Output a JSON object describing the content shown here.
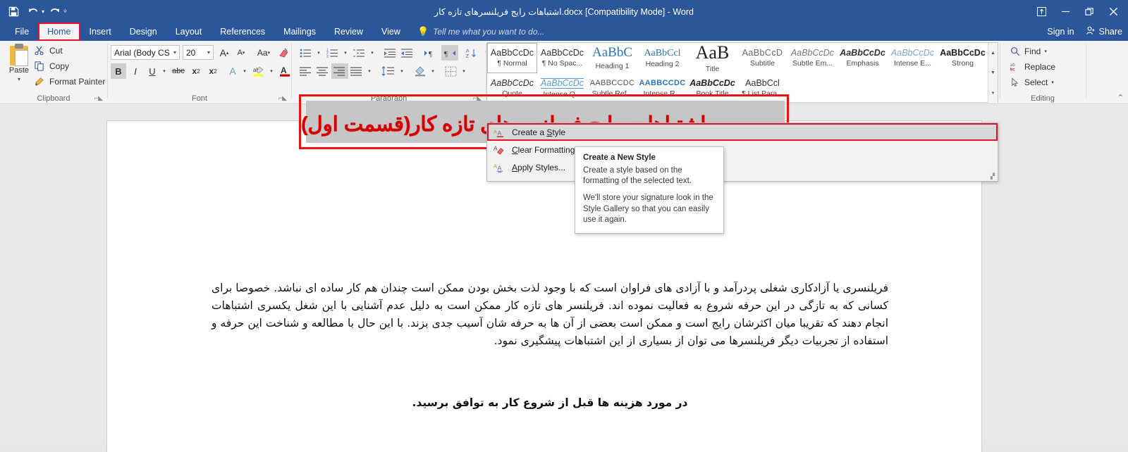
{
  "titlebar": {
    "document_title": "اشتباهات رایج فریلنسرهای تازه کار.docx [Compatibility Mode] - Word",
    "qat": [
      {
        "name": "save-icon",
        "glyph": "💾"
      },
      {
        "name": "undo-icon",
        "glyph": "↶"
      },
      {
        "name": "redo-icon",
        "glyph": "↷"
      },
      {
        "name": "customize-qat-icon",
        "glyph": "⌄"
      }
    ],
    "window_controls": [
      {
        "name": "ribbon-display-options-icon",
        "glyph": "⬆"
      },
      {
        "name": "minimize-icon",
        "glyph": "—"
      },
      {
        "name": "restore-icon",
        "glyph": "❐"
      },
      {
        "name": "close-icon",
        "glyph": "✕"
      }
    ]
  },
  "tabs": [
    {
      "label": "File",
      "active": false
    },
    {
      "label": "Home",
      "active": true
    },
    {
      "label": "Insert",
      "active": false
    },
    {
      "label": "Design",
      "active": false
    },
    {
      "label": "Layout",
      "active": false
    },
    {
      "label": "References",
      "active": false
    },
    {
      "label": "Mailings",
      "active": false
    },
    {
      "label": "Review",
      "active": false
    },
    {
      "label": "View",
      "active": false
    }
  ],
  "tell_me": {
    "text": "Tell me what you want to do...",
    "icon": "lightbulb-icon"
  },
  "account": {
    "sign_in": "Sign in",
    "share": "Share",
    "share_icon": "person-add-icon"
  },
  "ribbon": {
    "clipboard": {
      "group_label": "Clipboard",
      "paste_label": "Paste",
      "items": [
        {
          "label": "Cut",
          "icon": "scissors-icon"
        },
        {
          "label": "Copy",
          "icon": "copy-icon"
        },
        {
          "label": "Format Painter",
          "icon": "paintbrush-icon"
        }
      ]
    },
    "font": {
      "group_label": "Font",
      "font_name": "Arial (Body CS",
      "font_size": "20",
      "buttons": [
        {
          "name": "grow-font",
          "glyph": "A"
        },
        {
          "name": "shrink-font",
          "glyph": "A"
        },
        {
          "name": "change-case",
          "glyph": "Aa"
        },
        {
          "name": "clear-formatting",
          "glyph": "✐"
        },
        {
          "name": "bold",
          "glyph": "B",
          "active": true
        },
        {
          "name": "italic",
          "glyph": "I"
        },
        {
          "name": "underline",
          "glyph": "U"
        },
        {
          "name": "strikethrough",
          "glyph": "abc"
        },
        {
          "name": "subscript",
          "glyph": "x₂"
        },
        {
          "name": "superscript",
          "glyph": "x²"
        },
        {
          "name": "text-effects",
          "glyph": "A"
        },
        {
          "name": "text-highlight-color",
          "glyph": "ab"
        },
        {
          "name": "font-color",
          "glyph": "A"
        }
      ]
    },
    "paragraph": {
      "group_label": "Paragraph",
      "buttons": [
        {
          "name": "bullets",
          "glyph": "≣"
        },
        {
          "name": "numbering",
          "glyph": "≣"
        },
        {
          "name": "multilevel-list",
          "glyph": "≣"
        },
        {
          "name": "decrease-indent",
          "glyph": "⇥"
        },
        {
          "name": "increase-indent",
          "glyph": "⇤"
        },
        {
          "name": "ltr-text-direction",
          "glyph": "▶¶"
        },
        {
          "name": "rtl-text-direction",
          "glyph": "¶◀",
          "active": true
        },
        {
          "name": "sort",
          "glyph": "A↓"
        },
        {
          "name": "show-formatting-marks",
          "glyph": "¶"
        },
        {
          "name": "align-left",
          "glyph": "≡"
        },
        {
          "name": "align-center",
          "glyph": "≡"
        },
        {
          "name": "align-right",
          "glyph": "≡",
          "active": true
        },
        {
          "name": "justify",
          "glyph": "≡"
        },
        {
          "name": "line-spacing",
          "glyph": "↕"
        },
        {
          "name": "shading",
          "glyph": "◢"
        },
        {
          "name": "borders",
          "glyph": "▣"
        }
      ]
    },
    "styles": {
      "group_label": "Styles",
      "gallery": [
        [
          {
            "preview": "AaBbCcDc",
            "name": "¶ Normal",
            "selected": true,
            "style": "normal"
          },
          {
            "preview": "AaBbCcDc",
            "name": "¶ No Spac...",
            "style": "normal"
          },
          {
            "preview": "AaBbC",
            "name": "Heading 1",
            "style": "h1"
          },
          {
            "preview": "AaBbCcl",
            "name": "Heading 2",
            "style": "h2"
          },
          {
            "preview": "AaB",
            "name": "Title",
            "style": "title"
          },
          {
            "preview": "AaBbCcD",
            "name": "Subtitle",
            "style": "subtitle"
          },
          {
            "preview": "AaBbCcDc",
            "name": "Subtle Em...",
            "style": "subtle-em"
          },
          {
            "preview": "AaBbCcDc",
            "name": "Emphasis",
            "style": "emphasis"
          },
          {
            "preview": "AaBbCcDc",
            "name": "Intense E...",
            "style": "intense-em"
          },
          {
            "preview": "AaBbCcDc",
            "name": "Strong",
            "style": "strong"
          }
        ],
        [
          {
            "preview": "AaBbCcDc",
            "name": "Quote",
            "style": "quote"
          },
          {
            "preview": "AaBbCcDc",
            "name": "Intense Q...",
            "style": "intense-quote"
          },
          {
            "preview": "AABBCCDC",
            "name": "Subtle Ref...",
            "style": "subtle-ref"
          },
          {
            "preview": "AABBCCDC",
            "name": "Intense R...",
            "style": "intense-ref"
          },
          {
            "preview": "AaBbCcDc",
            "name": "Book Title",
            "style": "book-title"
          },
          {
            "preview": "AaBbCcl",
            "name": "¶ List Para...",
            "style": "list-para"
          }
        ]
      ],
      "menu": [
        {
          "label_before": "Create a ",
          "accel": "S",
          "label_after": "tyle",
          "icon": "create-style-icon",
          "highlighted": true
        },
        {
          "label_before": "",
          "accel": "C",
          "label_after": "lear Formatting",
          "icon": "clear-formatting-icon",
          "highlighted": false
        },
        {
          "label_before": "",
          "accel": "A",
          "label_after": "pply Styles...",
          "icon": "apply-styles-icon",
          "highlighted": false
        }
      ]
    },
    "editing": {
      "group_label": "Editing",
      "items": [
        {
          "label": "Find",
          "icon": "search-icon",
          "has_caret": true
        },
        {
          "label": "Replace",
          "icon": "replace-icon",
          "has_caret": false
        },
        {
          "label": "Select",
          "icon": "select-pointer-icon",
          "has_caret": true
        }
      ]
    },
    "collapse_icon": "chevron-up-icon"
  },
  "tooltip": {
    "title": "Create a New Style",
    "body_1": "Create a style based on the formatting of the selected text.",
    "body_2": "We'll store your signature look in the Style Gallery so that you can easily use it again."
  },
  "document": {
    "heading": "اشتباهات رایج فریلنسرهای تازه کار(قسمت اول)",
    "heading_color": "#d60000",
    "heading_highlight": "#c6c6c6",
    "selection_border_color": "#ee1111",
    "paragraph_1": "فریلنسری یا آزادکاری شغلی پردرآمد و با آزادی های فراوان است که با وجود لذت بخش بودن ممکن است چندان هم کار ساده ای نباشد. خصوصا برای کسانی که به تازگی در این حرفه شروع به فعالیت نموده اند. فریلنسر های تازه کار ممکن است به دلیل عدم آشنایی با این شغل یکسری اشتباهات انجام دهند که تقریبا میان اکثرشان رایج است و ممکن است بعضی از آن ها به حرفه شان آسیب جدی بزند. با این حال با مطالعه و شناخت این حرفه و استفاده از تجربیات دیگر فریلنسرها می توان از بسیاری از این اشتباهات پیشگیری نمود.",
    "subheading": "در مورد هزینه ها قبل از شروع کار به توافق برسید."
  }
}
